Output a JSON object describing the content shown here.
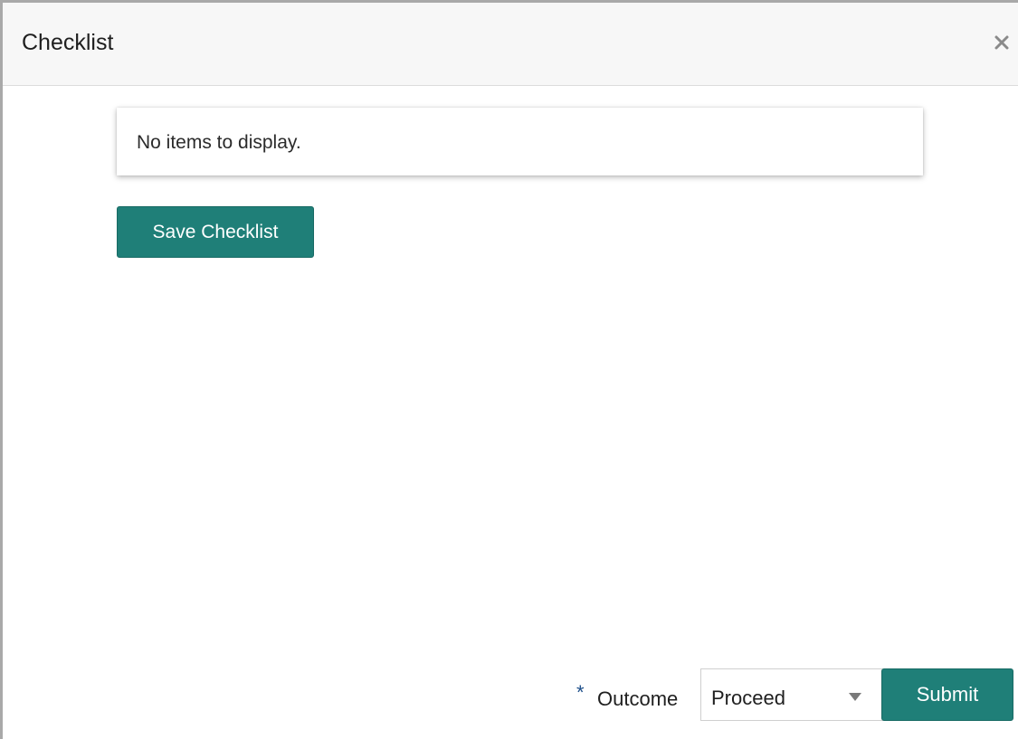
{
  "dialog": {
    "title": "Checklist",
    "close_icon": "close-icon"
  },
  "checklist": {
    "empty_message": "No items to display.",
    "save_label": "Save Checklist"
  },
  "footer": {
    "required_marker": "*",
    "outcome_label": "Outcome",
    "outcome_value": "Proceed",
    "dropdown_icon": "chevron-down-icon",
    "submit_label": "Submit"
  },
  "colors": {
    "accent": "#1f7f78",
    "required_marker": "#1e4f8a",
    "header_background": "#f7f7f7"
  }
}
